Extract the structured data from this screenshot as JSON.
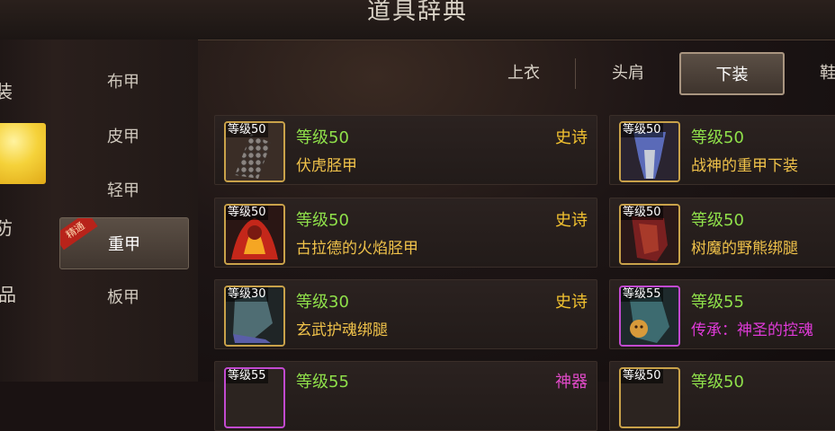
{
  "title": "道具辞典",
  "left_strip": {
    "items": [
      "装",
      "",
      "防",
      "品",
      ""
    ]
  },
  "sub_categories": [
    {
      "label": "布甲",
      "active": false
    },
    {
      "label": "皮甲",
      "active": false
    },
    {
      "label": "轻甲",
      "active": false
    },
    {
      "label": "重甲",
      "active": true,
      "ribbon": "精通"
    },
    {
      "label": "板甲",
      "active": false
    }
  ],
  "tabs": [
    {
      "label": "上衣",
      "active": false
    },
    {
      "label": "头肩",
      "active": false
    },
    {
      "label": "下装",
      "active": true
    },
    {
      "label": "鞋",
      "active": false
    }
  ],
  "items_left": [
    {
      "badge": "等级50",
      "level": "等级50",
      "name": "伏虎胫甲",
      "rarity": "史诗"
    },
    {
      "badge": "等级50",
      "level": "等级50",
      "name": "古拉德的火焰胫甲",
      "rarity": "史诗"
    },
    {
      "badge": "等级30",
      "level": "等级30",
      "name": "玄武护魂绑腿",
      "rarity": "史诗"
    },
    {
      "badge": "等级55",
      "level": "等级55",
      "name": "",
      "rarity": "神器"
    }
  ],
  "items_right": [
    {
      "badge": "等级50",
      "level": "等级50",
      "name": "战神的重甲下装"
    },
    {
      "badge": "等级50",
      "level": "等级50",
      "name": "树魔的野熊绑腿"
    },
    {
      "badge": "等级55",
      "level": "等级55",
      "name": "传承：神圣的控魂"
    },
    {
      "badge": "等级50",
      "level": "等级50",
      "name": ""
    }
  ],
  "colors": {
    "level_green": "#8fe04a",
    "name_gold": "#f0c24a",
    "rarity_epic": "#f2c230",
    "legacy_purple": "#e03ad9"
  }
}
